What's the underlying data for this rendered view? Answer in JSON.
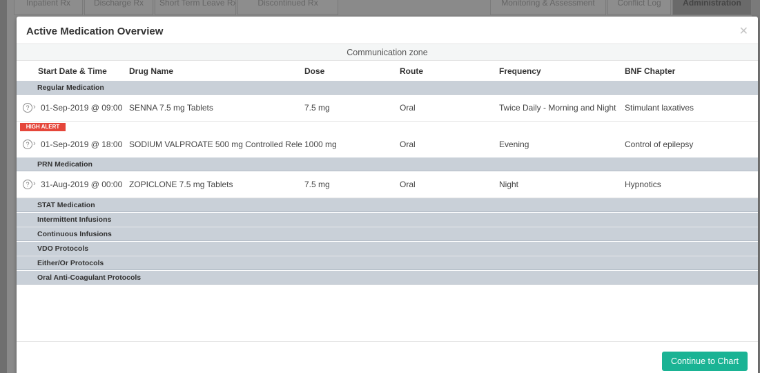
{
  "background": {
    "tabs": [
      {
        "label": "Inpatient Rx"
      },
      {
        "label": "Discharge Rx"
      },
      {
        "label": "Short Term Leave Rx"
      },
      {
        "label": "Discontinued Rx"
      },
      {
        "label": "Monitoring & Assessment"
      },
      {
        "label": "Conflict Log"
      },
      {
        "label": "Administration"
      }
    ]
  },
  "modal": {
    "title": "Active Medication Overview",
    "close_icon": "close-icon",
    "communication_zone": "Communication zone",
    "columns": {
      "start": "Start Date & Time",
      "drug": "Drug Name",
      "dose": "Dose",
      "route": "Route",
      "frequency": "Frequency",
      "bnf": "BNF Chapter"
    },
    "sections": {
      "regular": "Regular Medication",
      "prn": "PRN Medication",
      "stat": "STAT Medication",
      "intermittent": "Intermittent Infusions",
      "continuous": "Continuous Infusions",
      "vdo": "VDO Protocols",
      "either_or": "Either/Or Protocols",
      "oral_anticoag": "Oral Anti-Coagulant Protocols"
    },
    "rows": [
      {
        "icon": "help-circle-icon",
        "start": "01-Sep-2019 @ 09:00",
        "drug": "SENNA 7.5 mg Tablets",
        "dose": "7.5 mg",
        "route": "Oral",
        "frequency": "Twice Daily - Morning and Night",
        "bnf": "Stimulant laxatives"
      },
      {
        "icon": "help-circle-icon",
        "alert": "HIGH ALERT",
        "start": "01-Sep-2019 @ 18:00",
        "drug": "SODIUM VALPROATE 500 mg Controlled Rele...",
        "dose": "1000 mg",
        "route": "Oral",
        "frequency": "Evening",
        "bnf": "Control of epilepsy"
      },
      {
        "icon": "help-circle-icon",
        "start": "31-Aug-2019 @ 00:00",
        "drug": "ZOPICLONE 7.5 mg Tablets",
        "dose": "7.5 mg",
        "route": "Oral",
        "frequency": "Night",
        "bnf": "Hypnotics"
      }
    ],
    "continue_label": "Continue to Chart",
    "colors": {
      "section_bg": "#c9d0d8",
      "alert": "#e5463a",
      "primary": "#1ab394"
    }
  }
}
